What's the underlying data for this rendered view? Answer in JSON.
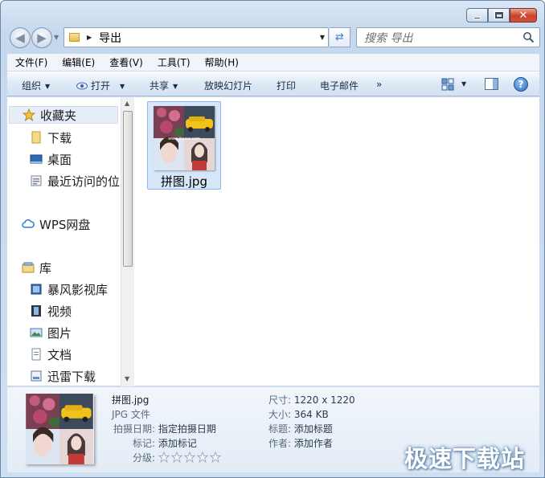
{
  "window": {
    "caption": {
      "minimize": "—",
      "maximize": "□",
      "close": "✕"
    }
  },
  "nav": {
    "address_path": "导出",
    "search_placeholder": "搜索 导出"
  },
  "menubar": {
    "items": [
      "文件(F)",
      "编辑(E)",
      "查看(V)",
      "工具(T)",
      "帮助(H)"
    ]
  },
  "commandbar": {
    "organize": "组织",
    "open": "打开",
    "share": "共享",
    "slideshow": "放映幻灯片",
    "print": "打印",
    "email": "电子邮件",
    "more": "»"
  },
  "sidebar": {
    "favorites": "收藏夹",
    "favorites_items": [
      "下载",
      "桌面",
      "最近访问的位"
    ],
    "wps": "WPS网盘",
    "library": "库",
    "library_items": [
      "暴风影视库",
      "视频",
      "图片",
      "文档",
      "迅雷下载"
    ]
  },
  "files": [
    {
      "name": "拼图.jpg",
      "selected": true,
      "icon": "image-thumbnail"
    }
  ],
  "details": {
    "file_name": "拼图.jpg",
    "file_type": "JPG 文件",
    "date_label": "拍摄日期:",
    "date_value": "指定拍摄日期",
    "tags_label": "标记:",
    "tags_value": "添加标记",
    "rating_label": "分级:",
    "rating": 0,
    "dimensions_label": "尺寸:",
    "dimensions_value": "1220 x 1220",
    "size_label": "大小:",
    "size_value": "364 KB",
    "title_label": "标题:",
    "title_value": "添加标题",
    "author_label": "作者:",
    "author_value": "添加作者"
  },
  "watermark": "极速下载站",
  "colors": {
    "selection": "#d7e7fa",
    "selection_border": "#8fb6e6",
    "frame": "#c6d8ee"
  }
}
